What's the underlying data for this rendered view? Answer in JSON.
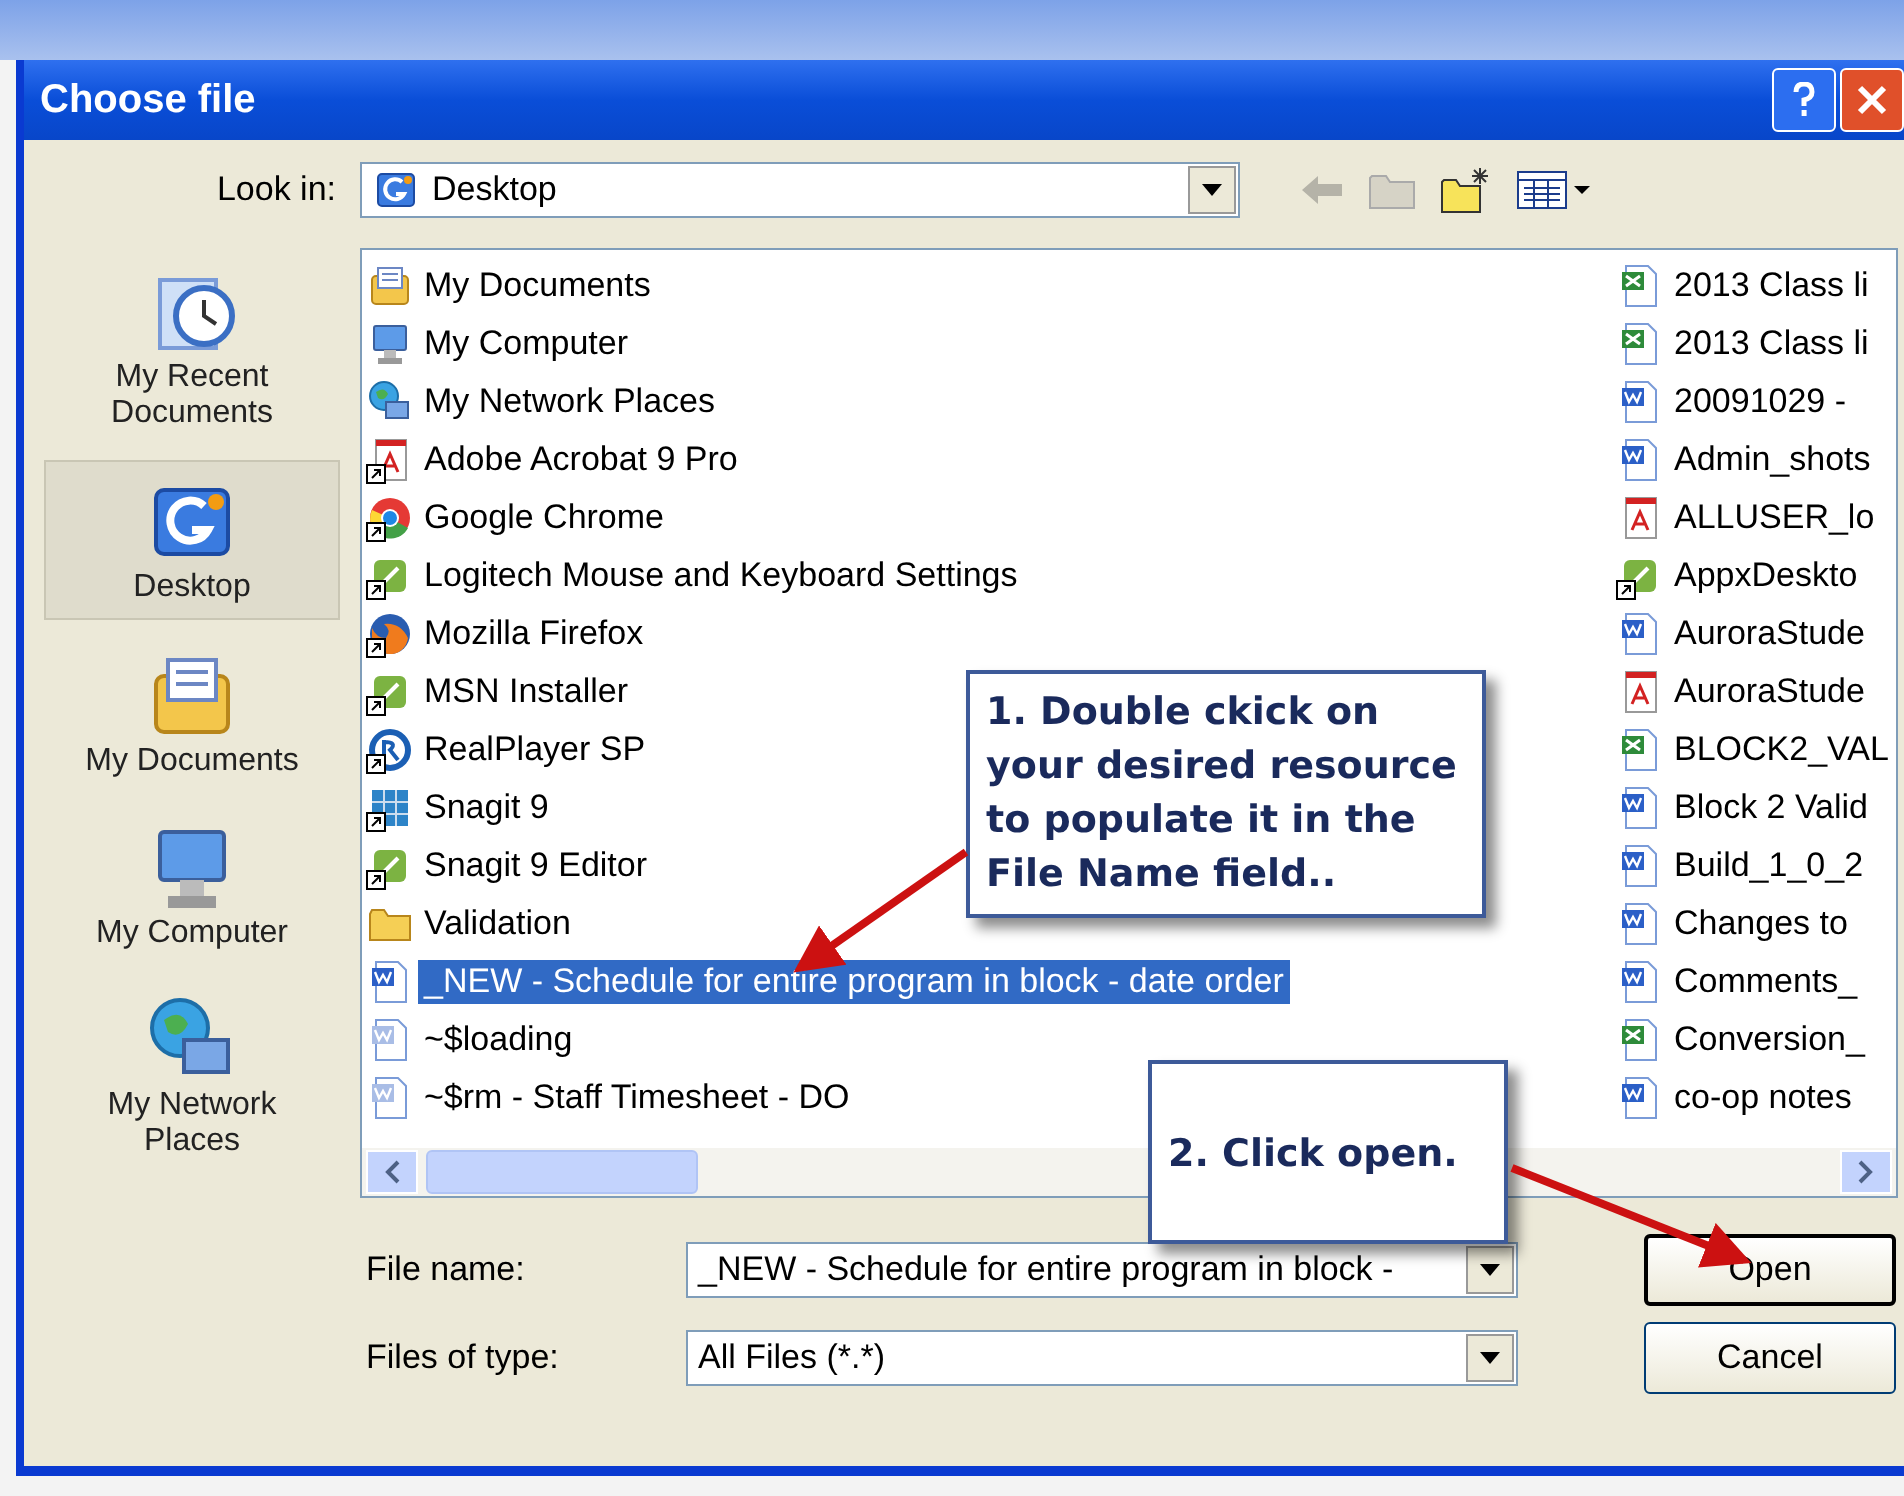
{
  "window": {
    "title": "Choose file"
  },
  "look_in": {
    "label": "Look in:",
    "value": "Desktop"
  },
  "places": [
    {
      "label": "My Recent Documents",
      "kind": "recent",
      "selected": false
    },
    {
      "label": "Desktop",
      "kind": "desktop",
      "selected": true
    },
    {
      "label": "My Documents",
      "kind": "documents",
      "selected": false
    },
    {
      "label": "My Computer",
      "kind": "computer",
      "selected": false
    },
    {
      "label": "My Network Places",
      "kind": "network",
      "selected": false
    }
  ],
  "files": {
    "column_1": [
      {
        "name": "My Documents",
        "kind": "documents",
        "shortcut": false,
        "selected": false
      },
      {
        "name": "My Computer",
        "kind": "computer",
        "shortcut": false,
        "selected": false
      },
      {
        "name": "My Network Places",
        "kind": "network",
        "shortcut": false,
        "selected": false
      },
      {
        "name": "Adobe Acrobat 9 Pro",
        "kind": "pdf",
        "shortcut": true,
        "selected": false
      },
      {
        "name": "Google Chrome",
        "kind": "chrome",
        "shortcut": true,
        "selected": false
      },
      {
        "name": "Logitech Mouse and Keyboard Settings",
        "kind": "app",
        "shortcut": true,
        "selected": false
      },
      {
        "name": "Mozilla Firefox",
        "kind": "firefox",
        "shortcut": true,
        "selected": false
      },
      {
        "name": "MSN Installer",
        "kind": "app",
        "shortcut": true,
        "selected": false
      },
      {
        "name": "RealPlayer SP",
        "kind": "player",
        "shortcut": true,
        "selected": false
      },
      {
        "name": "Snagit 9",
        "kind": "grid",
        "shortcut": true,
        "selected": false
      },
      {
        "name": "Snagit 9 Editor",
        "kind": "app",
        "shortcut": true,
        "selected": false
      },
      {
        "name": "Validation",
        "kind": "folder",
        "shortcut": false,
        "selected": false
      },
      {
        "name": "_NEW - Schedule for entire program in block - date order",
        "kind": "word",
        "shortcut": false,
        "selected": true
      },
      {
        "name": "~$loading",
        "kind": "word-temp",
        "shortcut": false,
        "selected": false
      },
      {
        "name": "~$rm - Staff Timesheet - DO",
        "kind": "word-temp",
        "shortcut": false,
        "selected": false
      }
    ],
    "column_2": [
      {
        "name": "2013 Class li",
        "kind": "excel",
        "shortcut": false,
        "selected": false
      },
      {
        "name": "2013 Class li",
        "kind": "excel",
        "shortcut": false,
        "selected": false
      },
      {
        "name": "20091029 -",
        "kind": "word",
        "shortcut": false,
        "selected": false
      },
      {
        "name": "Admin_shots",
        "kind": "word",
        "shortcut": false,
        "selected": false
      },
      {
        "name": "ALLUSER_lo",
        "kind": "pdf",
        "shortcut": false,
        "selected": false
      },
      {
        "name": "AppxDeskto",
        "kind": "app",
        "shortcut": true,
        "selected": false
      },
      {
        "name": "AuroraStude",
        "kind": "word",
        "shortcut": false,
        "selected": false
      },
      {
        "name": "AuroraStude",
        "kind": "pdf",
        "shortcut": false,
        "selected": false
      },
      {
        "name": "BLOCK2_VAL",
        "kind": "excel",
        "shortcut": false,
        "selected": false
      },
      {
        "name": "Block 2 Valid",
        "kind": "word",
        "shortcut": false,
        "selected": false
      },
      {
        "name": "Build_1_0_2",
        "kind": "word",
        "shortcut": false,
        "selected": false
      },
      {
        "name": "Changes to",
        "kind": "word",
        "shortcut": false,
        "selected": false
      },
      {
        "name": "Comments_",
        "kind": "word",
        "shortcut": false,
        "selected": false
      },
      {
        "name": "Conversion_",
        "kind": "excel",
        "shortcut": false,
        "selected": false
      },
      {
        "name": "co-op notes",
        "kind": "word",
        "shortcut": false,
        "selected": false
      }
    ]
  },
  "file_name": {
    "label": "File name:",
    "value": "_NEW - Schedule for entire program in block -"
  },
  "file_type": {
    "label": "Files of type:",
    "value": "All Files (*.*)"
  },
  "buttons": [
    {
      "label": "Open",
      "default": true
    },
    {
      "label": "Cancel",
      "default": false
    }
  ],
  "callouts": [
    {
      "text": "1. Double ckick on your desired resource to populate it in the File Name field.."
    },
    {
      "text": "2. Click open."
    }
  ]
}
